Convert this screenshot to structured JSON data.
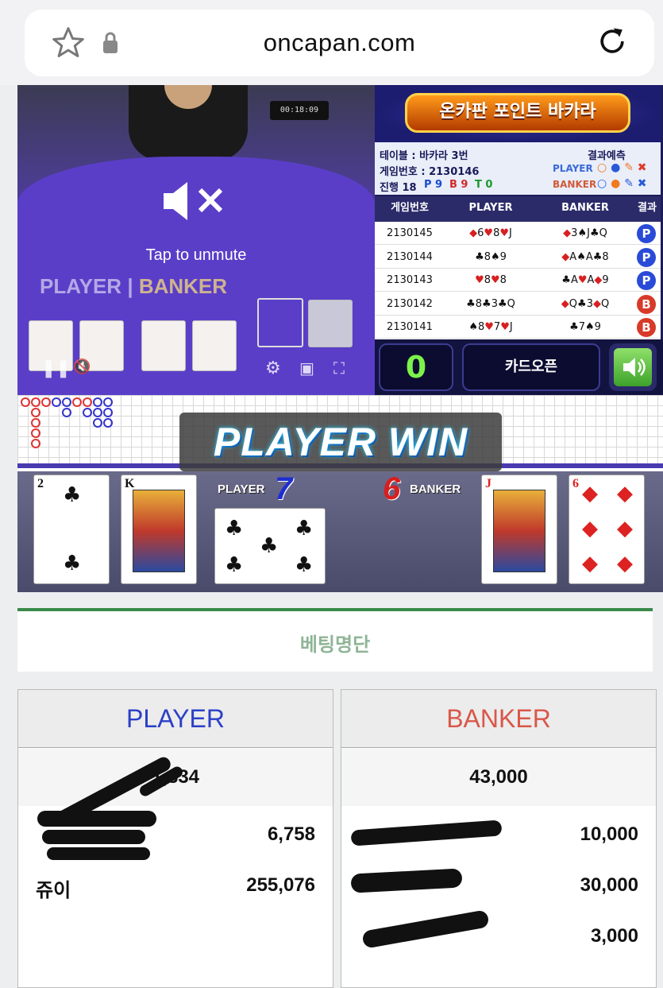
{
  "browser": {
    "url": "oncapan.com"
  },
  "video": {
    "clock": "00:18:09",
    "player_text": "PLAYER",
    "banker_text": "BANKER",
    "tap_unmute": "Tap to unmute"
  },
  "panel": {
    "banner_title": "온카판 포인트 바카라",
    "table_label": "테이블 : 바카라 3번",
    "game_no_label": "게임번호 : 2130146",
    "progress_label": "진행 18",
    "p_count": "P 9",
    "b_count": "B 9",
    "t_count": "T 0",
    "predict_label": "결과예측",
    "predict_player": "PLAYER",
    "predict_banker": "BANKER",
    "history_headers": [
      "게임번호",
      "PLAYER",
      "BANKER",
      "결과"
    ],
    "history": [
      {
        "no": "2130145",
        "player": "◆6♥8♥J",
        "banker": "◆3♠J♣Q",
        "result": "P"
      },
      {
        "no": "2130144",
        "player": "♣8♠9",
        "banker": "◆A♠A♣8",
        "result": "P"
      },
      {
        "no": "2130143",
        "player": "♥8♥8",
        "banker": "♣A♥A◆9",
        "result": "P"
      },
      {
        "no": "2130142",
        "player": "♣8♣3♣Q",
        "banker": "◆Q♣3◆Q",
        "result": "B"
      },
      {
        "no": "2130141",
        "player": "♠8♥7♥J",
        "banker": "♣7♠9",
        "result": "B"
      }
    ],
    "counter": "0",
    "open_label": "카드오픈"
  },
  "result": {
    "banner": "PLAYER WIN",
    "player_label": "PLAYER",
    "player_score": "7",
    "banker_label": "BANKER",
    "banker_score": "6",
    "player_cards": [
      {
        "rank": "2",
        "suit": "♣"
      },
      {
        "rank": "K",
        "suit": "♠"
      },
      {
        "rank": "5",
        "suit": "♣"
      }
    ],
    "banker_cards": [
      {
        "rank": "J",
        "suit": "♥"
      },
      {
        "rank": "6",
        "suit": "◆"
      }
    ]
  },
  "betting": {
    "title": "베팅명단",
    "player": {
      "header": "PLAYER",
      "header_color": "#2b3fc8",
      "total": "1,834",
      "rows": [
        {
          "name": "",
          "amount": "6,758"
        },
        {
          "name": "쥬이",
          "amount": "255,076"
        }
      ]
    },
    "banker": {
      "header": "BANKER",
      "header_color": "#d9574a",
      "total": "43,000",
      "rows": [
        {
          "name": "",
          "amount": "10,000"
        },
        {
          "name": "",
          "amount": "30,000"
        },
        {
          "name": "",
          "amount": "3,000"
        }
      ]
    }
  }
}
